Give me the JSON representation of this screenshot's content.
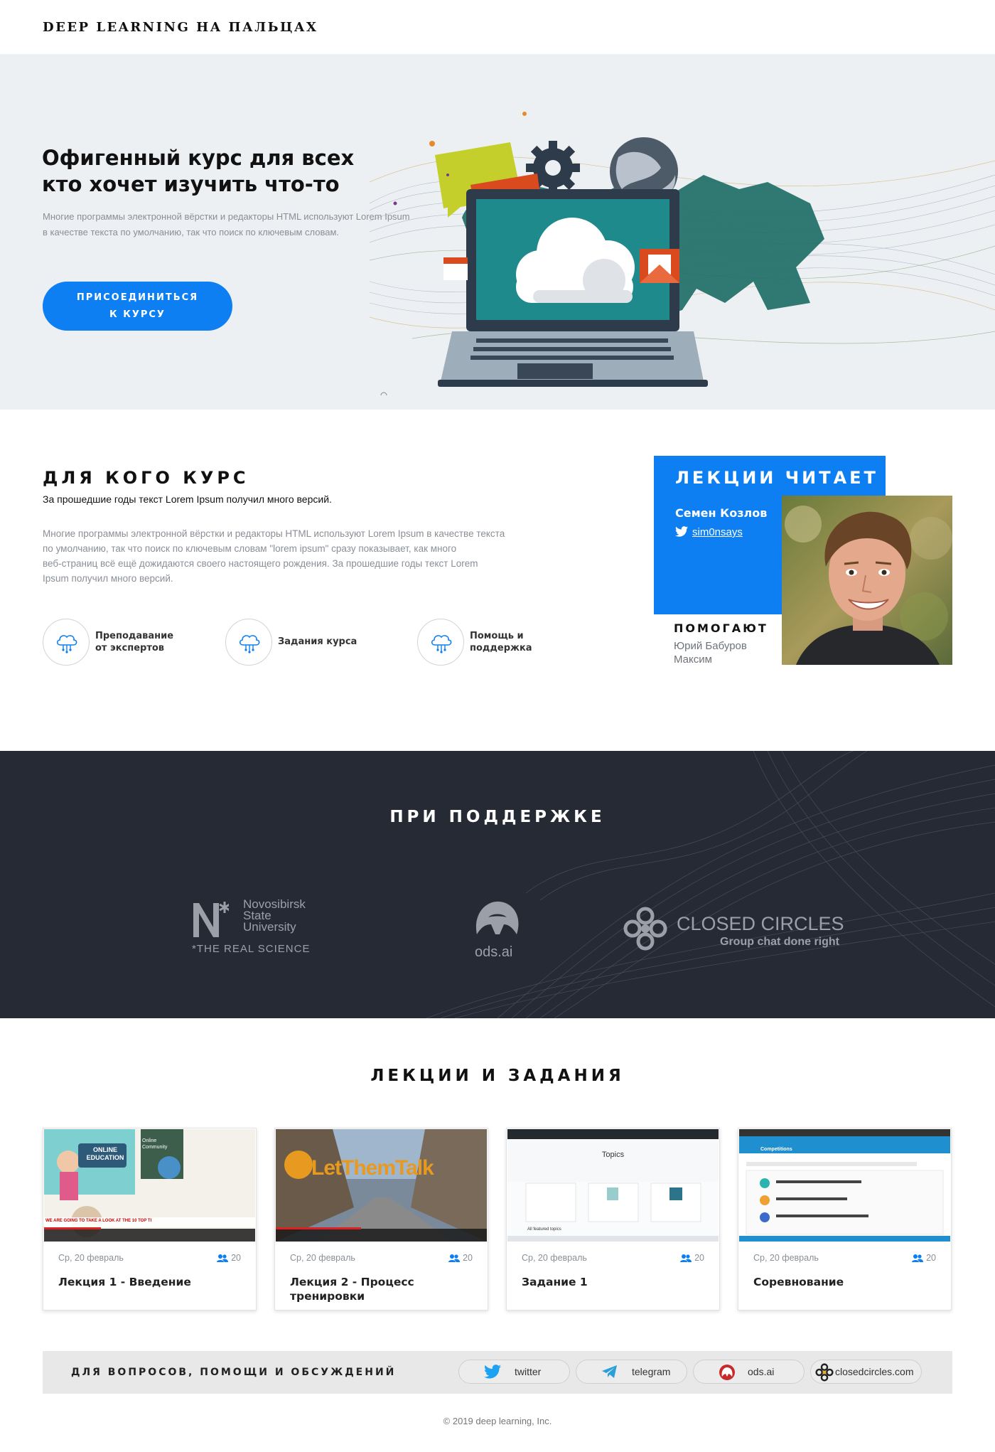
{
  "header": {
    "brand": "DEEP LEARNING НА ПАЛЬЦАХ"
  },
  "hero": {
    "title_line1": "Офигенный курс для всех",
    "title_line2": "кто хочет изучить что-то",
    "text_line1": "Многие программы электронной вёрстки и редакторы HTML используют Lorem Ipsum",
    "text_line2": "в качестве текста по умолчанию, так что поиск по ключевым словам.",
    "button_line1": "ПРИСОЕДИНИТЬСЯ",
    "button_line2": "К КУРСУ"
  },
  "who": {
    "title": "ДЛЯ КОГО КУРС",
    "subtitle": "За прошедшие годы текст Lorem Ipsum получил много версий.",
    "text_line1": "Многие программы электронной вёрстки и редакторы HTML используют Lorem Ipsum в качестве текста",
    "text_line2": "по умолчанию, так что поиск по ключевым словам \"lorem ipsum\" сразу показывает, как много",
    "text_line3": "веб-страниц всё ещё дожидаются своего настоящего рождения. За прошедшие годы текст Lorem",
    "text_line4": "Ipsum получил много версий.",
    "features": [
      {
        "line1": "Преподавание",
        "line2": "от экспертов"
      },
      {
        "line1": "Задания курса",
        "line2": ""
      },
      {
        "line1": "Помощь и",
        "line2": "поддержка"
      }
    ]
  },
  "lecturer": {
    "title": "ЛЕКЦИИ ЧИТАЕТ",
    "name": "Семен Козлов",
    "twitter": "sim0nsays",
    "helpers_title": "ПОМОГАЮТ",
    "helpers": [
      "Юрий Бабуров",
      "Максим"
    ]
  },
  "support": {
    "title": "ПРИ ПОДДЕРЖКЕ",
    "nsu": {
      "line1": "Novosibirsk",
      "line2": "State",
      "line3": "University",
      "tagline": "*THE REAL SCIENCE"
    },
    "ods": {
      "label": "ods.ai"
    },
    "cc": {
      "name": "CLOSED CIRCLES",
      "tagline": "Group chat done right"
    }
  },
  "lectures": {
    "title": "ЛЕКЦИИ И ЗАДАНИЯ",
    "cards": [
      {
        "date": "Ср, 20 февраль",
        "count": "20",
        "title": "Лекция 1 - Введение"
      },
      {
        "date": "Ср, 20 февраль",
        "count": "20",
        "title": "Лекция 2 - Процесс тренировки"
      },
      {
        "date": "Ср, 20 февраль",
        "count": "20",
        "title": "Задание 1"
      },
      {
        "date": "Ср, 20 февраль",
        "count": "20",
        "title": "Соревнование"
      }
    ],
    "thumb1": {
      "badge_line1": "ONLINE",
      "badge_line2": "EDUCATION",
      "community": "Online Community",
      "caption": "WE ARE GOING TO TAKE A LOOK AT THE 10 TOP TI"
    },
    "thumb2": {
      "overlay": "LetThemTalk"
    },
    "thumb3": {
      "heading": "Topics",
      "sub": "All featured topics"
    },
    "thumb4": {
      "heading": "Competitions"
    }
  },
  "contact": {
    "label": "ДЛЯ ВОПРОСОВ, ПОМОЩИ И ОБСУЖДЕНИЙ",
    "links": [
      "twitter",
      "telegram",
      "ods.ai",
      "closedcircles.com"
    ]
  },
  "footer": {
    "copyright": "© 2019 deep learning, Inc."
  },
  "colors": {
    "accent": "#0d7ff2",
    "dark": "#262a35",
    "hero_bg": "#edf0f3"
  }
}
